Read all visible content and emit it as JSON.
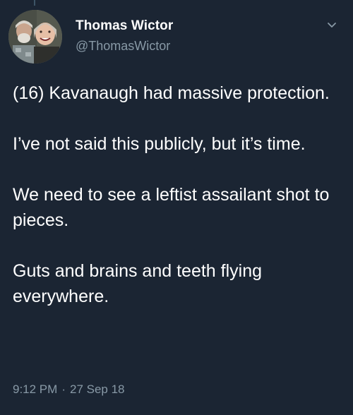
{
  "author": {
    "display_name": "Thomas Wictor",
    "handle": "@ThomasWictor"
  },
  "tweet": {
    "paragraphs": [
      "(16) Kavanaugh had massive protection.",
      "I’ve not said this publicly, but it’s time.",
      "We need to see a leftist assailant shot to pieces.",
      "Guts and brains and teeth flying everywhere."
    ],
    "time": "9:12 PM",
    "separator": "·",
    "date": "27 Sep 18"
  },
  "icons": {
    "caret": "chevron-down-icon"
  },
  "colors": {
    "background": "#1b2533",
    "text": "#ffffff",
    "secondary_text": "#8899a6"
  }
}
